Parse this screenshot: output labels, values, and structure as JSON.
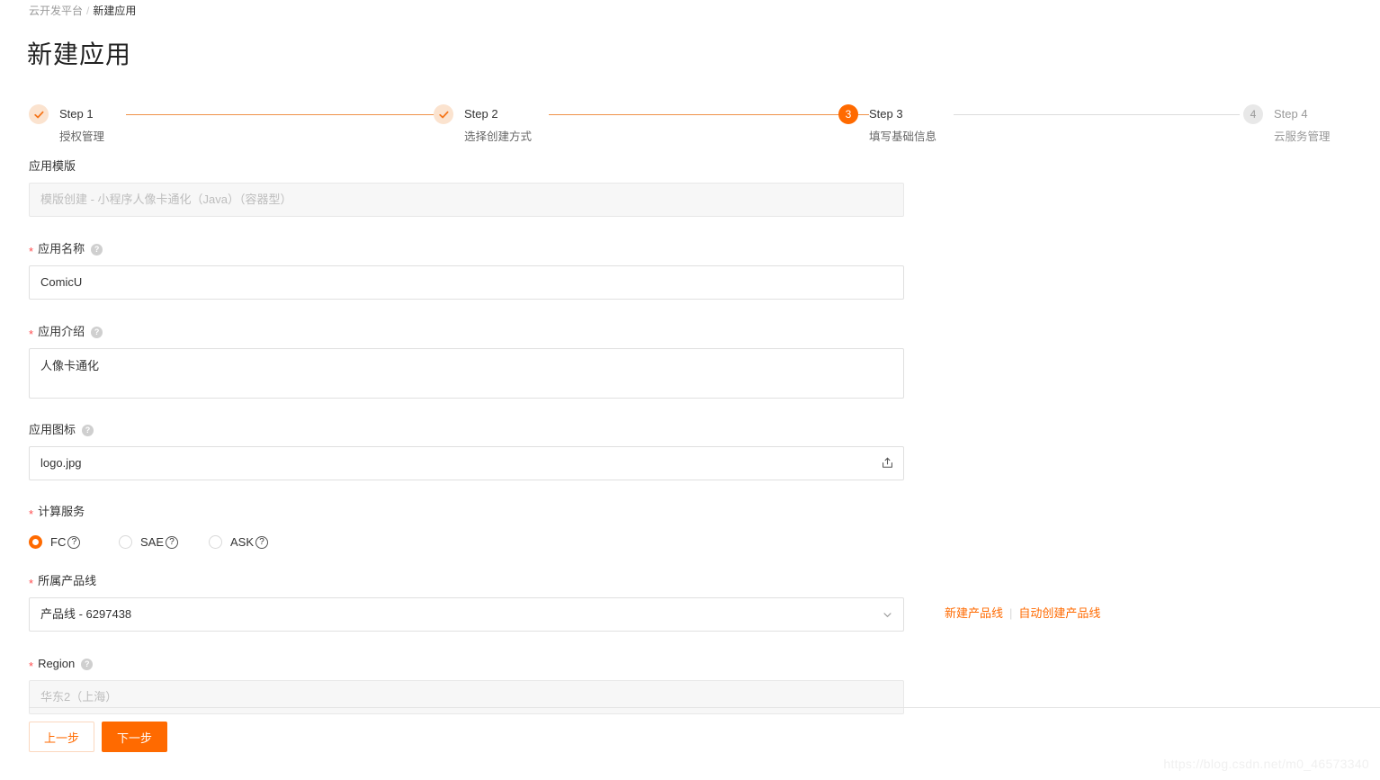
{
  "breadcrumb": {
    "root": "云开发平台",
    "separator": "/",
    "current": "新建应用"
  },
  "page_title": "新建应用",
  "steps": [
    {
      "index": "1",
      "label": "Step 1",
      "desc": "授权管理",
      "state": "done",
      "icon": "check-icon"
    },
    {
      "index": "2",
      "label": "Step 2",
      "desc": "选择创建方式",
      "state": "done",
      "icon": "check-icon"
    },
    {
      "index": "3",
      "label": "Step 3",
      "desc": "填写基础信息",
      "state": "active",
      "icon": ""
    },
    {
      "index": "4",
      "label": "Step 4",
      "desc": "云服务管理",
      "state": "todo",
      "icon": ""
    }
  ],
  "form": {
    "template": {
      "label": "应用模版",
      "value": "模版创建 - 小程序人像卡通化（Java）（容器型）",
      "disabled": true,
      "required": false
    },
    "app_name": {
      "label": "应用名称",
      "value": "ComicU",
      "required": true,
      "help": "?"
    },
    "app_desc": {
      "label": "应用介绍",
      "value": "人像卡通化",
      "required": true,
      "help": "?"
    },
    "app_icon": {
      "label": "应用图标",
      "value": "logo.jpg",
      "required": false,
      "help": "?",
      "upload_icon": "upload-icon"
    },
    "compute_service": {
      "label": "计算服务",
      "required": true,
      "selected": "FC",
      "options": [
        {
          "value": "FC",
          "label": "FC",
          "help": "?",
          "checked": true
        },
        {
          "value": "SAE",
          "label": "SAE",
          "help": "?",
          "checked": false
        },
        {
          "value": "ASK",
          "label": "ASK",
          "help": "?",
          "checked": false
        }
      ]
    },
    "product_line": {
      "label": "所属产品线",
      "value": "产品线 - 6297438",
      "required": true,
      "links": {
        "create": "新建产品线",
        "separator": "|",
        "auto_create": "自动创建产品线"
      }
    },
    "region": {
      "label": "Region",
      "value": "华东2（上海）",
      "required": true,
      "help": "?",
      "disabled": true
    }
  },
  "actions": {
    "prev_label": "上一步",
    "next_label": "下一步"
  },
  "watermark": "https://blog.csdn.net/m0_46573340",
  "colors": {
    "accent": "#ff6a00",
    "accent_light": "#fbe3cf",
    "required_star": "#ff4d4f",
    "border": "#e0e0e0",
    "disabled_bg": "#f7f7f7"
  }
}
